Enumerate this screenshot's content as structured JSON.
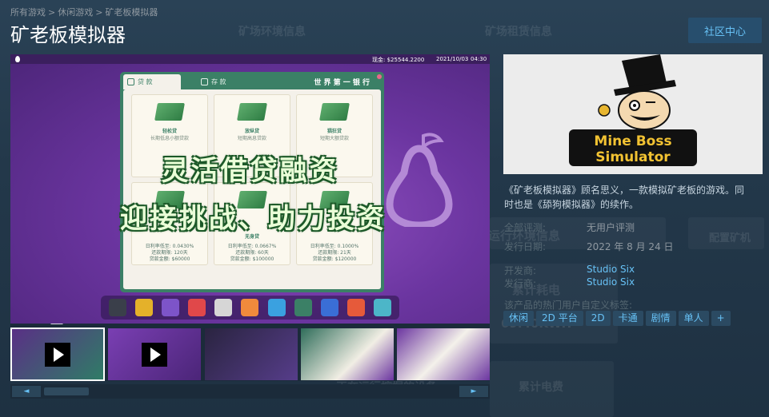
{
  "breadcrumb": {
    "items": [
      "所有游戏",
      "休闲游戏",
      "矿老板模拟器"
    ],
    "sep": ">"
  },
  "title": "矿老板模拟器",
  "community_button": "社区中心",
  "background_text": {
    "env_info": "矿场环境信息",
    "rent_info": "矿场租赁信息",
    "run_env": "运行环境信息",
    "power_cost": "累计耗电",
    "power_value": "69.40KWH",
    "running": "正在运行挖掘的设备",
    "power_fee": "累计电费",
    "config": "配置矿机"
  },
  "screenshot": {
    "cash": "现金: $25544.2200",
    "date": "2021/10/03",
    "time": "04:30",
    "tab_loan": "贷 款",
    "tab_deposit": "存 款",
    "bank_name": "世 界 第 一 银 行",
    "cards": [
      {
        "name": "轻松贷",
        "sub": "长期低息小额贷款",
        "rows": []
      },
      {
        "name": "放纵贷",
        "sub": "短期高息贷款",
        "rows": []
      },
      {
        "name": "猖狂贷",
        "sub": "短期大额贷款",
        "rows": []
      },
      {
        "name": "",
        "sub": "",
        "rows": [
          "日利率低至: 0.0430%",
          "还款期限: 120天",
          "贷款金额: $60000"
        ]
      },
      {
        "name": "无身贷",
        "sub": "",
        "rows": [
          "日利率低至: 0.0667%",
          "还款期限: 60天",
          "贷款金额: $100000"
        ]
      },
      {
        "name": "",
        "sub": "",
        "rows": [
          "日利率低至: 0.1000%",
          "还款期限: 21天",
          "贷款金额: $120000"
        ]
      }
    ],
    "overlay_line1": "灵活借贷融资",
    "overlay_line2": "迎接挑战、助力投资"
  },
  "capsule": {
    "line1": "Mine Boss",
    "line2": "Simulator"
  },
  "description": "《矿老板模拟器》顾名思义，一款模拟矿老板的游戏。同时也是《舔狗模拟器》的续作。",
  "info": {
    "reviews_label": "全部评测:",
    "reviews_value": "无用户评测",
    "release_label": "发行日期:",
    "release_value": "2022 年 8 月 24 日",
    "developer_label": "开发商:",
    "developer_value": "Studio Six",
    "publisher_label": "发行商:",
    "publisher_value": "Studio Six"
  },
  "tags_label": "该产品的热门用户自定义标签:",
  "tags": [
    "休闲",
    "2D 平台",
    "2D",
    "卡通",
    "剧情",
    "单人",
    "+"
  ],
  "scroll": {
    "left": "◄",
    "right": "►"
  },
  "colors": {
    "accent": "#67c1f5",
    "bank_green": "#3b8066",
    "button_bg": "#274e6d"
  }
}
